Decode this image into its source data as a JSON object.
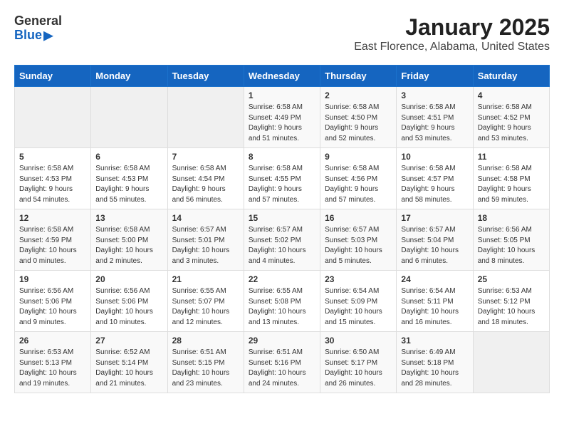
{
  "header": {
    "logo": {
      "line1": "General",
      "line2": "Blue"
    },
    "title": "January 2025",
    "subtitle": "East Florence, Alabama, United States"
  },
  "weekdays": [
    "Sunday",
    "Monday",
    "Tuesday",
    "Wednesday",
    "Thursday",
    "Friday",
    "Saturday"
  ],
  "weeks": [
    [
      {
        "day": null,
        "info": null
      },
      {
        "day": null,
        "info": null
      },
      {
        "day": null,
        "info": null
      },
      {
        "day": "1",
        "info": "Sunrise: 6:58 AM\nSunset: 4:49 PM\nDaylight: 9 hours and 51 minutes."
      },
      {
        "day": "2",
        "info": "Sunrise: 6:58 AM\nSunset: 4:50 PM\nDaylight: 9 hours and 52 minutes."
      },
      {
        "day": "3",
        "info": "Sunrise: 6:58 AM\nSunset: 4:51 PM\nDaylight: 9 hours and 53 minutes."
      },
      {
        "day": "4",
        "info": "Sunrise: 6:58 AM\nSunset: 4:52 PM\nDaylight: 9 hours and 53 minutes."
      }
    ],
    [
      {
        "day": "5",
        "info": "Sunrise: 6:58 AM\nSunset: 4:53 PM\nDaylight: 9 hours and 54 minutes."
      },
      {
        "day": "6",
        "info": "Sunrise: 6:58 AM\nSunset: 4:53 PM\nDaylight: 9 hours and 55 minutes."
      },
      {
        "day": "7",
        "info": "Sunrise: 6:58 AM\nSunset: 4:54 PM\nDaylight: 9 hours and 56 minutes."
      },
      {
        "day": "8",
        "info": "Sunrise: 6:58 AM\nSunset: 4:55 PM\nDaylight: 9 hours and 57 minutes."
      },
      {
        "day": "9",
        "info": "Sunrise: 6:58 AM\nSunset: 4:56 PM\nDaylight: 9 hours and 57 minutes."
      },
      {
        "day": "10",
        "info": "Sunrise: 6:58 AM\nSunset: 4:57 PM\nDaylight: 9 hours and 58 minutes."
      },
      {
        "day": "11",
        "info": "Sunrise: 6:58 AM\nSunset: 4:58 PM\nDaylight: 9 hours and 59 minutes."
      }
    ],
    [
      {
        "day": "12",
        "info": "Sunrise: 6:58 AM\nSunset: 4:59 PM\nDaylight: 10 hours and 0 minutes."
      },
      {
        "day": "13",
        "info": "Sunrise: 6:58 AM\nSunset: 5:00 PM\nDaylight: 10 hours and 2 minutes."
      },
      {
        "day": "14",
        "info": "Sunrise: 6:57 AM\nSunset: 5:01 PM\nDaylight: 10 hours and 3 minutes."
      },
      {
        "day": "15",
        "info": "Sunrise: 6:57 AM\nSunset: 5:02 PM\nDaylight: 10 hours and 4 minutes."
      },
      {
        "day": "16",
        "info": "Sunrise: 6:57 AM\nSunset: 5:03 PM\nDaylight: 10 hours and 5 minutes."
      },
      {
        "day": "17",
        "info": "Sunrise: 6:57 AM\nSunset: 5:04 PM\nDaylight: 10 hours and 6 minutes."
      },
      {
        "day": "18",
        "info": "Sunrise: 6:56 AM\nSunset: 5:05 PM\nDaylight: 10 hours and 8 minutes."
      }
    ],
    [
      {
        "day": "19",
        "info": "Sunrise: 6:56 AM\nSunset: 5:06 PM\nDaylight: 10 hours and 9 minutes."
      },
      {
        "day": "20",
        "info": "Sunrise: 6:56 AM\nSunset: 5:06 PM\nDaylight: 10 hours and 10 minutes."
      },
      {
        "day": "21",
        "info": "Sunrise: 6:55 AM\nSunset: 5:07 PM\nDaylight: 10 hours and 12 minutes."
      },
      {
        "day": "22",
        "info": "Sunrise: 6:55 AM\nSunset: 5:08 PM\nDaylight: 10 hours and 13 minutes."
      },
      {
        "day": "23",
        "info": "Sunrise: 6:54 AM\nSunset: 5:09 PM\nDaylight: 10 hours and 15 minutes."
      },
      {
        "day": "24",
        "info": "Sunrise: 6:54 AM\nSunset: 5:11 PM\nDaylight: 10 hours and 16 minutes."
      },
      {
        "day": "25",
        "info": "Sunrise: 6:53 AM\nSunset: 5:12 PM\nDaylight: 10 hours and 18 minutes."
      }
    ],
    [
      {
        "day": "26",
        "info": "Sunrise: 6:53 AM\nSunset: 5:13 PM\nDaylight: 10 hours and 19 minutes."
      },
      {
        "day": "27",
        "info": "Sunrise: 6:52 AM\nSunset: 5:14 PM\nDaylight: 10 hours and 21 minutes."
      },
      {
        "day": "28",
        "info": "Sunrise: 6:51 AM\nSunset: 5:15 PM\nDaylight: 10 hours and 23 minutes."
      },
      {
        "day": "29",
        "info": "Sunrise: 6:51 AM\nSunset: 5:16 PM\nDaylight: 10 hours and 24 minutes."
      },
      {
        "day": "30",
        "info": "Sunrise: 6:50 AM\nSunset: 5:17 PM\nDaylight: 10 hours and 26 minutes."
      },
      {
        "day": "31",
        "info": "Sunrise: 6:49 AM\nSunset: 5:18 PM\nDaylight: 10 hours and 28 minutes."
      },
      {
        "day": null,
        "info": null
      }
    ]
  ]
}
